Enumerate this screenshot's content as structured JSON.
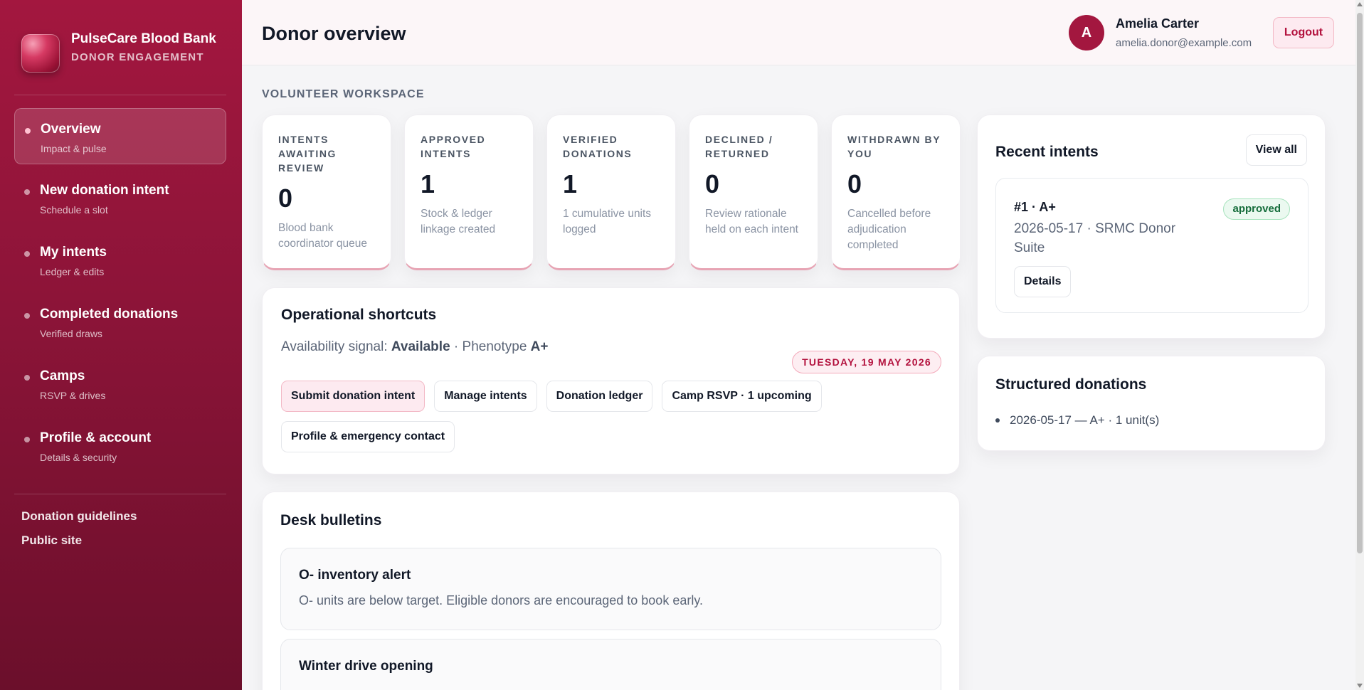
{
  "brand": {
    "name": "PulseCare Blood Bank",
    "tagline": "DONOR ENGAGEMENT"
  },
  "nav": [
    {
      "label": "Overview",
      "sub": "Impact & pulse",
      "active": true
    },
    {
      "label": "New donation intent",
      "sub": "Schedule a slot"
    },
    {
      "label": "My intents",
      "sub": "Ledger & edits"
    },
    {
      "label": "Completed donations",
      "sub": "Verified draws"
    },
    {
      "label": "Camps",
      "sub": "RSVP & drives"
    },
    {
      "label": "Profile & account",
      "sub": "Details & security"
    }
  ],
  "side_links": [
    "Donation guidelines",
    "Public site"
  ],
  "header": {
    "title": "Donor overview",
    "avatar_initial": "A",
    "user_name": "Amelia Carter",
    "user_email": "amelia.donor@example.com",
    "logout_label": "Logout"
  },
  "workspace_label": "VOLUNTEER WORKSPACE",
  "stats": [
    {
      "label": "INTENTS AWAITING REVIEW",
      "value": "0",
      "note": "Blood bank coordinator queue"
    },
    {
      "label": "APPROVED INTENTS",
      "value": "1",
      "note": "Stock & ledger linkage created"
    },
    {
      "label": "VERIFIED DONATIONS",
      "value": "1",
      "note": "1 cumulative units logged"
    },
    {
      "label": "DECLINED / RETURNED",
      "value": "0",
      "note": "Review rationale held on each intent"
    },
    {
      "label": "WITHDRAWN BY YOU",
      "value": "0",
      "note": "Cancelled before adjudication completed"
    }
  ],
  "ops": {
    "title": "Operational shortcuts",
    "availability_prefix": "Availability signal:",
    "availability_value": "Available",
    "phenotype_prefix": "· Phenotype",
    "phenotype_value": "A+",
    "date": "TUESDAY, 19 MAY 2026",
    "buttons": [
      "Submit donation intent",
      "Manage intents",
      "Donation ledger",
      "Camp RSVP · 1 upcoming",
      "Profile & emergency contact"
    ]
  },
  "bulletins": {
    "title": "Desk bulletins",
    "items": [
      {
        "title": "O- inventory alert",
        "body": "O- units are below target. Eligible donors are encouraged to book early."
      },
      {
        "title": "Winter drive opening",
        "body": ""
      }
    ]
  },
  "recent": {
    "title": "Recent intents",
    "view_all": "View all",
    "intent": {
      "title": "#1 · A+",
      "meta": "2026-05-17 · SRMC Donor Suite",
      "status": "approved",
      "details": "Details"
    }
  },
  "structured": {
    "title": "Structured donations",
    "items": [
      "2026-05-17 — A+ · 1 unit(s)"
    ]
  },
  "colors": {
    "brand": "#a3173f",
    "accent_soft": "#fdeaf0",
    "approved": "#146c3a"
  }
}
